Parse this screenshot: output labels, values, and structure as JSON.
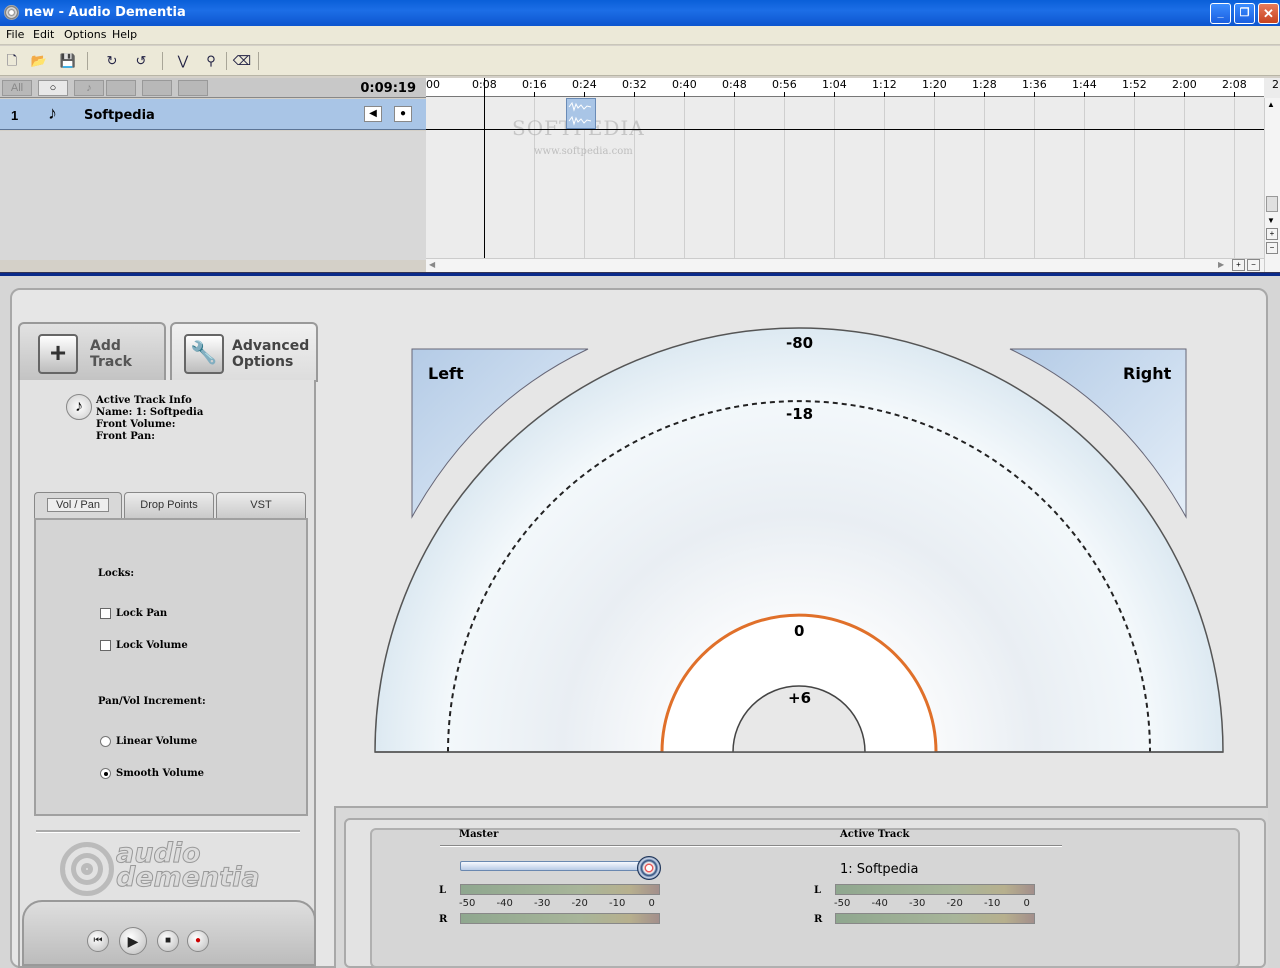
{
  "window": {
    "title": "new - Audio Dementia",
    "min": "_",
    "max": "❐",
    "close": "✕"
  },
  "menu": [
    "File",
    "Edit",
    "Options",
    "Help"
  ],
  "toolbar_icons": [
    "new-file-icon",
    "open-folder-icon",
    "save-icon",
    "undo-icon",
    "redo-icon",
    "envelope-icon",
    "marker-icon",
    "eraser-icon"
  ],
  "track_header": {
    "tabs": [
      "All",
      "○",
      "♪",
      "",
      "",
      ""
    ],
    "time": "0:09:19"
  },
  "tracks": [
    {
      "number": "1",
      "name": "Softpedia"
    }
  ],
  "ruler": {
    "ticks": [
      "00",
      "0:08",
      "0:16",
      "0:24",
      "0:32",
      "0:40",
      "0:48",
      "0:56",
      "1:04",
      "1:12",
      "1:20",
      "1:28",
      "1:36",
      "1:44",
      "1:52",
      "2:00",
      "2:08",
      "2:"
    ]
  },
  "watermark": {
    "main": "SOFTPEDIA",
    "sub": "www.softpedia.com"
  },
  "sidebar": {
    "add_track": {
      "line1": "Add",
      "line2": "Track"
    },
    "advanced": {
      "line1": "Advanced",
      "line2": "Options"
    },
    "track_info": {
      "heading": "Active Track Info",
      "name": "Name: 1: Softpedia",
      "front_volume": "Front Volume:",
      "front_pan": "Front Pan:"
    },
    "subtabs": [
      "Vol / Pan",
      "Drop Points",
      "VST"
    ],
    "locks_label": "Locks:",
    "lock_pan": "Lock Pan",
    "lock_volume": "Lock Volume",
    "increment_label": "Pan/Vol Increment:",
    "linear_volume": "Linear Volume",
    "smooth_volume": "Smooth Volume",
    "logo_line1": "audio",
    "logo_line2": "dementia"
  },
  "dial": {
    "left": "Left",
    "right": "Right",
    "db_outer": "-80",
    "db_mid": "-18",
    "db_zero": "0",
    "db_plus": "+6"
  },
  "mixer": {
    "master_label": "Master",
    "active_label": "Active Track",
    "active_track_name": "1: Softpedia",
    "ch_left": "L",
    "ch_right": "R",
    "scale": [
      "-50",
      "-40",
      "-30",
      "-20",
      "-10",
      "0"
    ]
  }
}
